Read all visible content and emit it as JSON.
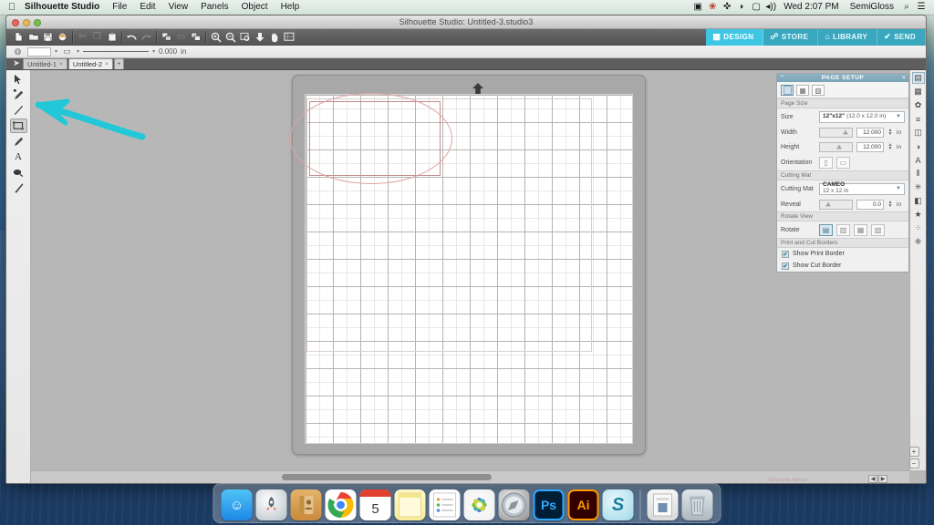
{
  "menubar": {
    "apple_icon": "apple-logo",
    "app_name": "Silhouette Studio",
    "menus": [
      "File",
      "Edit",
      "View",
      "Panels",
      "Object",
      "Help"
    ],
    "status_icons": [
      "display-icon",
      "dropbox-icon",
      "bluetooth-icon",
      "wifi-icon",
      "airplay-icon",
      "volume-icon"
    ],
    "clock": "Wed 2:07 PM",
    "user": "SemiGloss",
    "search_icon": "search-icon",
    "control_center_icon": "menu-list-icon"
  },
  "window": {
    "title": "Silhouette Studio: Untitled-3.studio3",
    "traffic_lights": [
      "close",
      "minimize",
      "zoom"
    ]
  },
  "toolbar": {
    "groups": [
      {
        "buttons": [
          {
            "name": "new-document-button",
            "icon": "page-icon",
            "enabled": true
          },
          {
            "name": "open-document-button",
            "icon": "folder-icon",
            "enabled": true
          },
          {
            "name": "save-document-button",
            "icon": "floppy-disk-icon",
            "enabled": true
          },
          {
            "name": "save-as-button",
            "icon": "disc-icon",
            "enabled": true
          }
        ]
      },
      {
        "buttons": [
          {
            "name": "cut-button",
            "icon": "scissors-icon",
            "enabled": false
          },
          {
            "name": "copy-button",
            "icon": "copy-icon",
            "enabled": false
          },
          {
            "name": "paste-button",
            "icon": "clipboard-icon",
            "enabled": true
          }
        ]
      },
      {
        "buttons": [
          {
            "name": "undo-button",
            "icon": "undo-arrow-icon",
            "enabled": true
          },
          {
            "name": "redo-button",
            "icon": "redo-arrow-icon",
            "enabled": false
          }
        ]
      },
      {
        "buttons": [
          {
            "name": "group-button",
            "icon": "group-icon",
            "enabled": true
          },
          {
            "name": "ungroup-button",
            "icon": "ungroup-icon",
            "enabled": false
          },
          {
            "name": "weld-button",
            "icon": "weld-icon",
            "enabled": true
          }
        ]
      },
      {
        "buttons": [
          {
            "name": "zoom-in-button",
            "icon": "magnifier-plus-icon",
            "enabled": true
          },
          {
            "name": "zoom-out-button",
            "icon": "magnifier-minus-icon",
            "enabled": true
          },
          {
            "name": "zoom-selection-button",
            "icon": "zoom-selection-icon",
            "enabled": true
          },
          {
            "name": "fit-to-page-button",
            "icon": "down-arrow-icon",
            "enabled": true
          },
          {
            "name": "pan-button",
            "icon": "hand-icon",
            "enabled": true
          },
          {
            "name": "fit-window-button",
            "icon": "fit-window-icon",
            "enabled": true
          }
        ]
      }
    ]
  },
  "mode_tabs": [
    {
      "label": "DESIGN",
      "icon": "grid-icon",
      "active": true
    },
    {
      "label": "STORE",
      "icon": "cart-icon",
      "active": false
    },
    {
      "label": "LIBRARY",
      "icon": "library-icon",
      "active": false
    },
    {
      "label": "SEND",
      "icon": "check-icon",
      "active": false
    }
  ],
  "style_toolbar": {
    "fill_icon": "fill-swatch-icon",
    "fill_value": "",
    "line_icon": "line-swatch-icon",
    "line_value": "",
    "line_style_icon": "solid-line-icon",
    "line_width_value": "0.000",
    "line_width_unit": "in"
  },
  "document_tabs": {
    "cursor_icon": "arrow-cursor-icon",
    "tabs": [
      {
        "label": "Untitled-1",
        "active": false,
        "close_icon": "×"
      },
      {
        "label": "Untitled-2",
        "active": true,
        "close_icon": "×"
      }
    ],
    "add_label": "+"
  },
  "tools": [
    {
      "name": "select-tool",
      "icon": "arrow-cursor-icon",
      "glyph": "➤",
      "active": false
    },
    {
      "name": "edit-points-tool",
      "icon": "node-edit-icon",
      "glyph": "✎",
      "active": false
    },
    {
      "name": "line-tool",
      "icon": "line-icon",
      "glyph": "╱",
      "active": false
    },
    {
      "name": "rectangle-tool",
      "icon": "rectangle-icon",
      "glyph": "▭",
      "active": true
    },
    {
      "name": "draw-tool",
      "icon": "pencil-icon",
      "glyph": "✐",
      "active": false
    },
    {
      "name": "text-tool",
      "icon": "text-a-icon",
      "glyph": "A",
      "active": false
    },
    {
      "name": "eraser-tool",
      "icon": "eraser-icon",
      "glyph": "◗",
      "active": false
    },
    {
      "name": "knife-tool",
      "icon": "knife-icon",
      "glyph": "⟋",
      "active": false
    }
  ],
  "annotation": {
    "type": "arrow",
    "color": "#22c8d8",
    "points_to": "rectangle-tool"
  },
  "canvas": {
    "mat_arrow_icon": "mat-load-arrow-icon",
    "shape": {
      "name": "ellipse",
      "stroke_color": "#e0a2a2"
    },
    "print_border_color": "#d9cfcf"
  },
  "page_setup": {
    "panel_title": "PAGE SETUP",
    "collapse_icon": "chevron-icon",
    "close_icon": "×",
    "tabs": [
      {
        "name": "page-tab",
        "icon": "page-icon",
        "active": true
      },
      {
        "name": "grid-tab",
        "icon": "grid-icon",
        "active": false
      },
      {
        "name": "registration-tab",
        "icon": "reg-marks-icon",
        "active": false
      }
    ],
    "sections": {
      "page_size": {
        "heading": "Page Size",
        "size_label": "Size",
        "size_value_main": "12\"x12\"",
        "size_value_sub": "(12.0 x 12.0 in)",
        "width_label": "Width",
        "width_value": "12.000",
        "width_unit": "in",
        "height_label": "Height",
        "height_value": "12.000",
        "height_unit": "in",
        "orientation_label": "Orientation",
        "orientation_options": [
          "portrait-icon",
          "landscape-icon"
        ]
      },
      "cutting_mat": {
        "heading": "Cutting Mat",
        "mat_label": "Cutting Mat",
        "mat_value_main": "CAMEO",
        "mat_value_sub": "12 x 12 in",
        "reveal_label": "Reveal",
        "reveal_value": "0.0",
        "reveal_unit": "in"
      },
      "rotate_view": {
        "heading": "Rotate View",
        "rotate_label": "Rotate",
        "options": [
          "rotate-0-icon",
          "rotate-90-icon",
          "rotate-180-icon",
          "rotate-270-icon"
        ],
        "active_index": 0
      },
      "print_cut_borders": {
        "heading": "Print and Cut Borders",
        "show_print_border_label": "Show Print Border",
        "show_print_border_checked": true,
        "show_cut_border_label": "Show Cut Border",
        "show_cut_border_checked": true
      }
    }
  },
  "right_rail": [
    {
      "name": "page-setup-rail-icon",
      "glyph": "▤",
      "active": true
    },
    {
      "name": "cut-settings-rail-icon",
      "glyph": "▦",
      "active": false
    },
    {
      "name": "sketch-rail-icon",
      "glyph": "✿",
      "active": false
    },
    {
      "name": "align-rail-icon",
      "glyph": "≡",
      "active": false
    },
    {
      "name": "transform-rail-icon",
      "glyph": "◫",
      "active": false
    },
    {
      "name": "modify-rail-icon",
      "glyph": "◑",
      "active": false
    },
    {
      "name": "text-style-rail-icon",
      "glyph": "A",
      "active": false
    },
    {
      "name": "pageframe-rail-icon",
      "glyph": "⦀",
      "active": false
    },
    {
      "name": "effects-rail-icon",
      "glyph": "✳",
      "active": false
    },
    {
      "name": "fill-rail-icon",
      "glyph": "◧",
      "active": false
    },
    {
      "name": "library-rail-icon",
      "glyph": "★",
      "active": false
    },
    {
      "name": "store-rail-icon",
      "glyph": "⁘",
      "active": false
    },
    {
      "name": "tracing-rail-icon",
      "glyph": "❈",
      "active": false
    }
  ],
  "status_bar": {
    "watermark": "Silhouette School",
    "zoom_in_icon": "+",
    "zoom_out_icon": "−",
    "nav_prev_icon": "◀",
    "nav_next_icon": "▶"
  },
  "dock": [
    {
      "name": "dock-finder",
      "label": "Finder",
      "glyph": "☺",
      "running": true
    },
    {
      "name": "dock-launchpad",
      "label": "Launchpad",
      "glyph": "🚀",
      "running": false
    },
    {
      "name": "dock-contacts",
      "label": "Contacts",
      "glyph": "▤",
      "running": false
    },
    {
      "name": "dock-chrome",
      "label": "Google Chrome",
      "glyph": "◉",
      "running": true
    },
    {
      "name": "dock-calendar",
      "label": "Calendar",
      "glyph": "5",
      "running": false
    },
    {
      "name": "dock-notes",
      "label": "Notes",
      "glyph": "▭",
      "running": false
    },
    {
      "name": "dock-reminders",
      "label": "Reminders",
      "glyph": "☰",
      "running": false
    },
    {
      "name": "dock-photos",
      "label": "Photos",
      "glyph": "✺",
      "running": false
    },
    {
      "name": "dock-safari",
      "label": "Safari",
      "glyph": "◎",
      "running": false
    },
    {
      "name": "dock-photoshop",
      "label": "Ps",
      "glyph": "Ps",
      "running": false
    },
    {
      "name": "dock-illustrator",
      "label": "Ai",
      "glyph": "Ai",
      "running": false
    },
    {
      "name": "dock-silhouette-studio",
      "label": "Silhouette Studio",
      "glyph": "S",
      "running": true
    },
    {
      "name": "dock-document",
      "label": "Document",
      "glyph": "▤",
      "running": false
    },
    {
      "name": "dock-trash",
      "label": "Trash",
      "glyph": "🗑",
      "running": false
    }
  ]
}
